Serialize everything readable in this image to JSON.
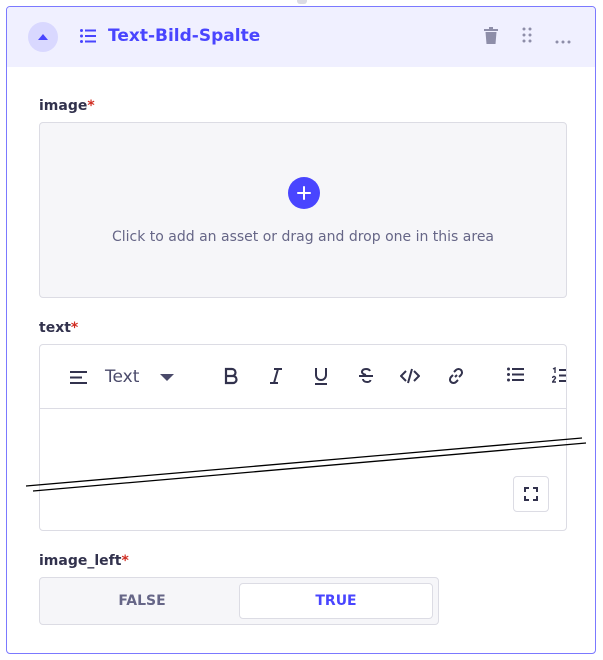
{
  "header": {
    "title": "Text-Bild-Spalte",
    "actions": [
      "trash-icon",
      "drag-handle-icon",
      "more-icon"
    ]
  },
  "fields": {
    "image": {
      "label": "image",
      "required_mark": "*",
      "dropzone_text": "Click to add an asset or drag and drop one in this area"
    },
    "text": {
      "label": "text",
      "required_mark": "*",
      "toolbar": {
        "block_type": "Text",
        "buttons": [
          "bold",
          "italic",
          "underline",
          "strikethrough",
          "code",
          "link",
          "bulleted-list",
          "numbered-list"
        ]
      }
    },
    "image_left": {
      "label": "image_left",
      "required_mark": "*",
      "options": [
        "FALSE",
        "TRUE"
      ],
      "selected": "TRUE"
    }
  },
  "colors": {
    "accent": "#4945ff",
    "header_bg": "#f0f0ff",
    "required": "#d02b20",
    "border": "#dcdce4",
    "muted_text": "#666687"
  }
}
